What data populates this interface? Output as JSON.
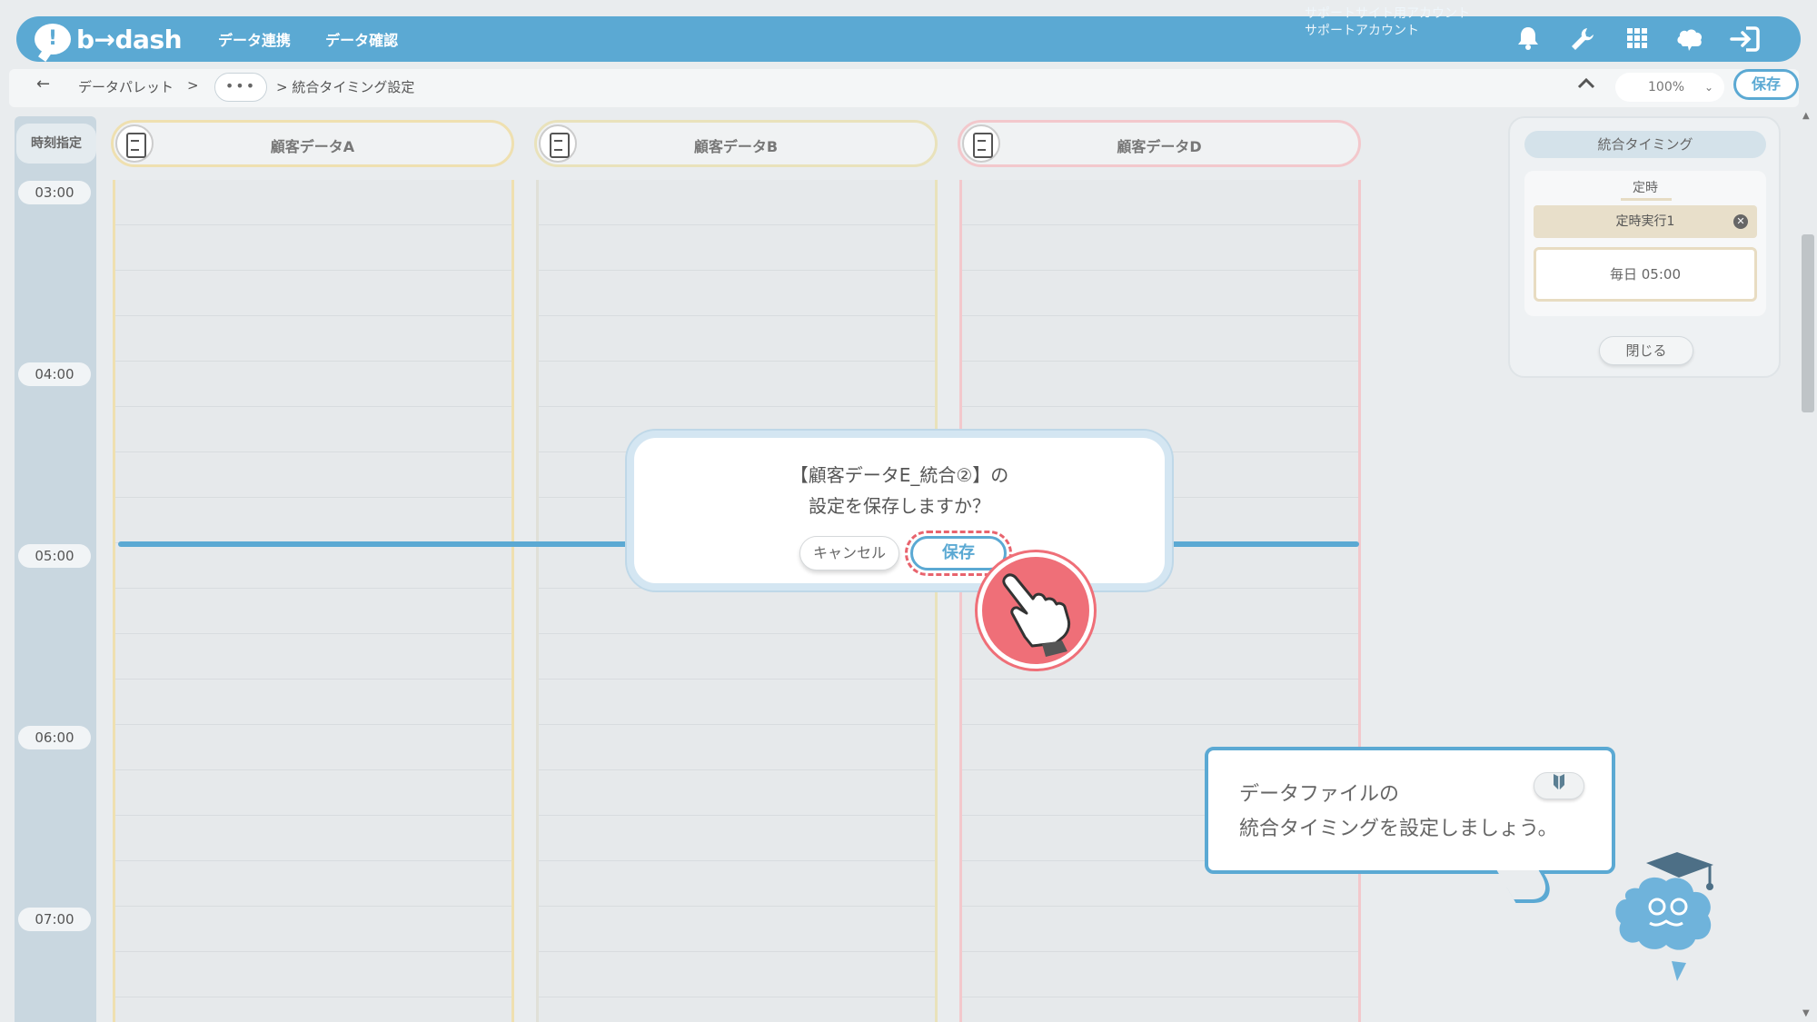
{
  "app": {
    "logo_text": "b→dash"
  },
  "nav": {
    "items": [
      "データ連携",
      "データ確認"
    ]
  },
  "account": {
    "line1": "サポートサイト用アカウント",
    "line2": "サポートアカウント"
  },
  "topbar_icons": [
    "bell-icon",
    "wrench-icon",
    "grid-icon",
    "brain-icon",
    "logout-icon"
  ],
  "breadcrumb": {
    "back": "←",
    "root": "データパレット",
    "sep": ">",
    "ellipsis": "•••",
    "current": "> 統合タイミング設定"
  },
  "toolbar": {
    "zoom": "100%",
    "save_label": "保存"
  },
  "schedule": {
    "time_header": "時刻指定",
    "times": [
      "03:00",
      "04:00",
      "05:00",
      "06:00",
      "07:00"
    ],
    "columns": [
      {
        "label": "顧客データA",
        "border": "#efe0b0"
      },
      {
        "label": "顧客データB",
        "border": "#e9e2bb"
      },
      {
        "label": "顧客データD",
        "border": "#f3c8cc"
      }
    ]
  },
  "panel": {
    "title": "統合タイミング",
    "subtitle": "定時",
    "job_name": "定時実行1",
    "remove_symbol": "✕",
    "schedule": "毎日 05:00",
    "close_label": "閉じる"
  },
  "dialog": {
    "line1": "【顧客データE_統合②】の",
    "line2": "設定を保存しますか？",
    "cancel_label": "キャンセル",
    "save_label": "保存"
  },
  "tip": {
    "line1": "データファイルの",
    "line2": "統合タイミングを設定しましょう。",
    "badge_icon": "beginner-mark-icon"
  },
  "colors": {
    "accent": "#5ba9d3",
    "highlight": "#e8636d"
  }
}
